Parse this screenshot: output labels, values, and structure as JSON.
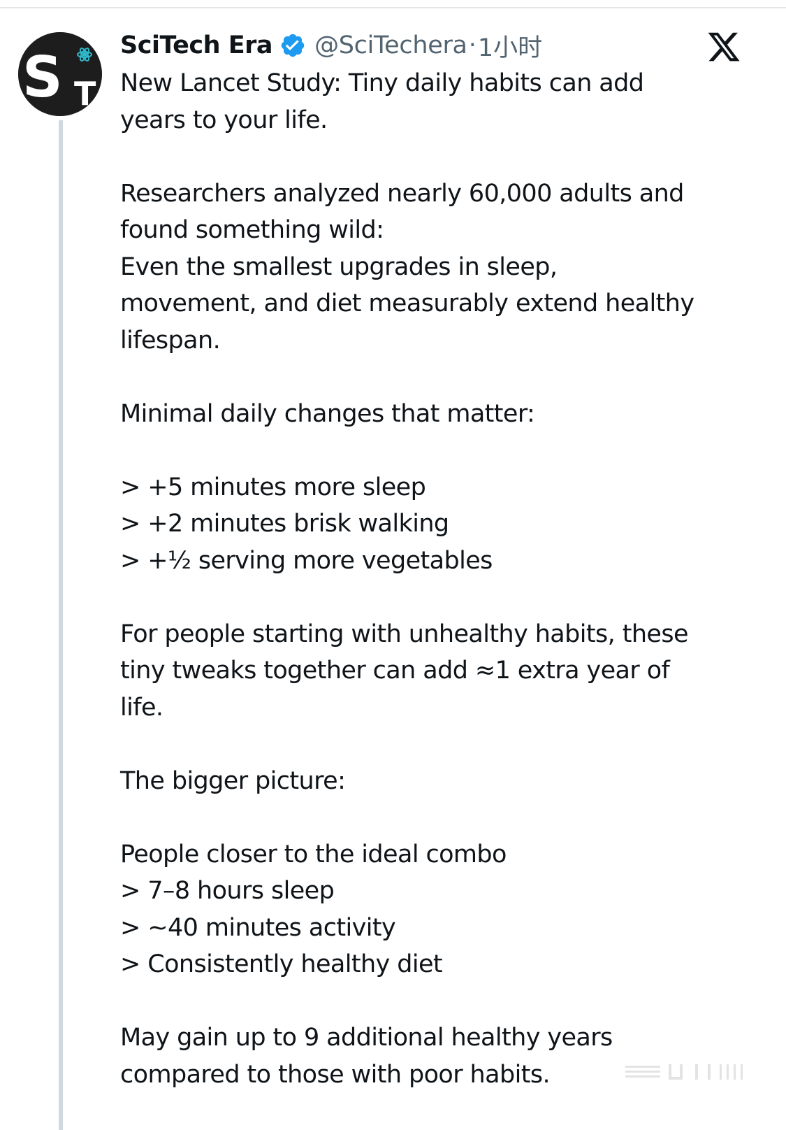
{
  "tweet": {
    "display_name": "SciTech Era",
    "handle": "@SciTechera",
    "separator": "·",
    "time": "1小时",
    "avatar_icon": "scitech-logo",
    "verified_icon": "verified-badge-icon",
    "platform_icon": "x-logo-icon",
    "paragraphs": [
      {
        "lines": [
          "New Lancet Study: Tiny daily habits can add",
          "years to your life."
        ]
      },
      {
        "lines": [
          "Researchers analyzed nearly 60,000 adults and",
          "found something wild:",
          "Even the smallest upgrades in sleep,",
          "movement, and diet measurably extend healthy",
          "lifespan."
        ]
      },
      {
        "lines": [
          "Minimal daily changes that matter:"
        ]
      },
      {
        "lines": [
          "> +5 minutes more sleep",
          "> +2 minutes brisk walking",
          "> +½ serving more vegetables"
        ]
      },
      {
        "lines": [
          "For people starting with unhealthy habits, these",
          "tiny tweaks together can add ≈1 extra year of",
          "life."
        ]
      },
      {
        "lines": [
          "The bigger picture:"
        ]
      },
      {
        "lines": [
          "People closer to the ideal combo",
          "> 7–8 hours sleep",
          "> ~40 minutes activity",
          "> Consistently healthy diet"
        ]
      },
      {
        "lines": [
          "May gain up to 9 additional healthy years",
          "compared to those with poor habits."
        ]
      }
    ]
  },
  "colors": {
    "text": "#0f1419",
    "secondary": "#536471",
    "verified": "#1d9bf0",
    "avatar_bg": "#1d1d1d",
    "thread_line": "#cfd9de"
  }
}
